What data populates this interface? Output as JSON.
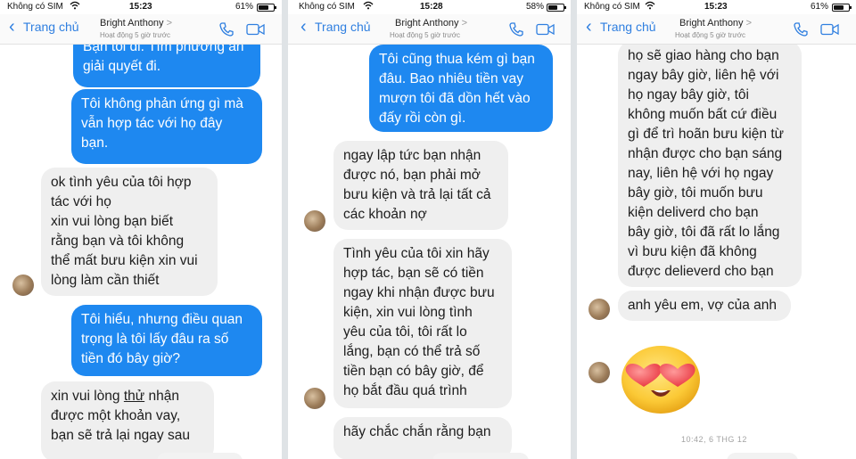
{
  "screens": [
    {
      "status": {
        "carrier": "Không có SIM",
        "time": "15:23",
        "battery": "61%",
        "battery_level": 0.61
      },
      "header": {
        "back_label": "Trang chủ",
        "contact_name": "Bright Anthony",
        "subtitle": "Hoạt động 5 giờ trước"
      },
      "messages": [
        {
          "dir": "out",
          "lines": [
            "Bạn tôi đi. Tìm phương án",
            "giải quyết đi."
          ]
        },
        {
          "dir": "out",
          "lines": [
            "Tôi không phản ứng gì mà",
            "vẫn hợp tác với họ đây",
            "bạn."
          ]
        },
        {
          "dir": "in",
          "lines": [
            "ok tình yêu của tôi hợp",
            "tác với họ",
            "xin vui lòng bạn biết",
            "rằng bạn và tôi không",
            "thể mất bưu kiện xin vui",
            "lòng làm cần thiết"
          ]
        },
        {
          "dir": "out",
          "lines": [
            "Tôi hiểu, nhưng điều quan",
            "trọng là tôi lấy đâu ra số",
            "tiền đó bây giờ?"
          ]
        },
        {
          "dir": "in",
          "lines": [
            "xin vui lòng thử nhận",
            "được một khoản vay,",
            "bạn sẽ trả lại ngay sau"
          ]
        }
      ]
    },
    {
      "status": {
        "carrier": "Không có SIM",
        "time": "15:28",
        "battery": "58%",
        "battery_level": 0.58
      },
      "header": {
        "back_label": "Trang chủ",
        "contact_name": "Bright Anthony",
        "subtitle": "Hoạt động 5 giờ trước"
      },
      "messages": [
        {
          "dir": "out",
          "lines": [
            "Tôi cũng thua kém gì bạn",
            "đâu. Bao nhiêu tiền vay",
            "mượn tôi đã dồn hết vào",
            "đấy rồi còn gì."
          ]
        },
        {
          "dir": "in",
          "lines": [
            "ngay lập tức bạn nhận",
            "được nó, bạn phải mở",
            "bưu kiện và trả lại tất cả",
            "các khoản nợ"
          ]
        },
        {
          "dir": "in",
          "lines": [
            "Tình yêu của tôi xin hãy",
            "hợp tác, bạn sẽ có tiền",
            "ngay khi nhận được bưu",
            "kiện, xin vui lòng tình",
            "yêu của tôi, tôi rất lo",
            "lắng, bạn có thể trả số",
            "tiền bạn có bây giờ, để",
            "họ bắt đầu quá trình"
          ]
        },
        {
          "dir": "in",
          "lines": [
            "hãy chắc chắn rằng bạn"
          ]
        }
      ]
    },
    {
      "status": {
        "carrier": "Không có SIM",
        "time": "15:23",
        "battery": "61%",
        "battery_level": 0.61
      },
      "header": {
        "back_label": "Trang chủ",
        "contact_name": "Bright Anthony",
        "subtitle": "Hoạt động 5 giờ trước"
      },
      "messages": [
        {
          "dir": "in",
          "lines": [
            "họ sẽ giao hàng cho bạn",
            "ngay bây giờ, liên hệ với",
            "họ ngay bây giờ, tôi",
            "không muốn bất cứ điều",
            "gì để trì hoãn bưu kiện từ",
            "nhận được cho bạn sáng",
            "nay, liên hệ với họ ngay",
            "bây giờ, tôi muốn bưu",
            "kiện deliverd cho bạn",
            "bây giờ, tôi đã rất lo lắng",
            "vì bưu kiện đã không",
            "được delieverd cho bạn"
          ]
        },
        {
          "dir": "in",
          "lines": [
            "anh yêu em, vợ của anh"
          ]
        }
      ],
      "emoji": "heart-eyes-emoji",
      "timestamp": "10:42, 6 THG 12"
    }
  ],
  "colors": {
    "outgoing": "#1e88f0",
    "incoming": "#efefef",
    "accent": "#2f7fe0"
  }
}
